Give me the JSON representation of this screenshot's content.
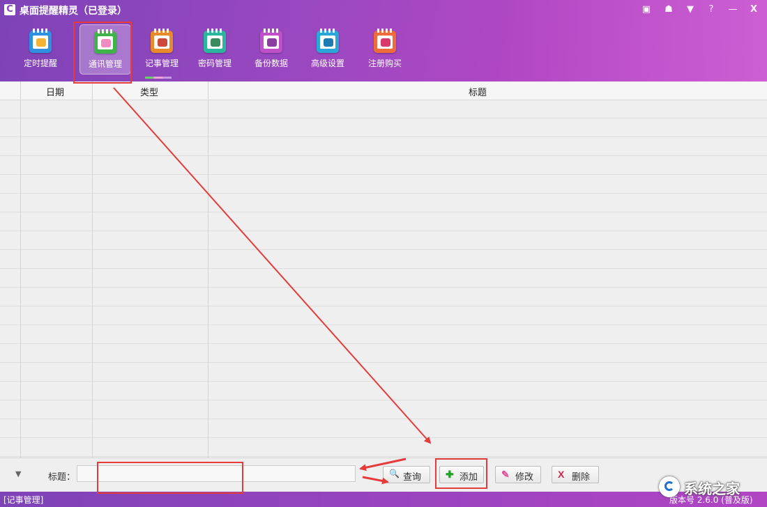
{
  "app": {
    "title": "桌面提醒精灵（已登录）",
    "logo_glyph": "C"
  },
  "window_controls": [
    {
      "name": "calendar-icon",
      "glyph": "▣"
    },
    {
      "name": "skin-icon",
      "glyph": "☗"
    },
    {
      "name": "menu-dropdown-icon",
      "glyph": "▼"
    },
    {
      "name": "help-icon",
      "glyph": "?"
    },
    {
      "name": "minimize-icon",
      "glyph": "—"
    },
    {
      "name": "close-icon",
      "glyph": "X"
    }
  ],
  "nav": {
    "items": [
      {
        "label": "定时提醒",
        "color": "#2f8fe0",
        "mark": "#f5b335",
        "icon": "alarm-clock-icon"
      },
      {
        "label": "通讯管理",
        "color": "#3fb24a",
        "mark": "#f08ac0",
        "icon": "contact-book-icon"
      },
      {
        "label": "记事管理",
        "color": "#e88a2c",
        "mark": "#cc4a3a",
        "icon": "notepad-pencil-icon"
      },
      {
        "label": "密码管理",
        "color": "#2bb6a0",
        "mark": "#3a8a60",
        "icon": "lock-icon"
      },
      {
        "label": "备份数据",
        "color": "#c050c8",
        "mark": "#8b3ea0",
        "icon": "floppy-disk-icon"
      },
      {
        "label": "高级设置",
        "color": "#2aa7d8",
        "mark": "#1e7db0",
        "icon": "gear-icon"
      },
      {
        "label": "注册购买",
        "color": "#f06b3a",
        "mark": "#d83a6a",
        "icon": "shopping-cart-icon"
      }
    ],
    "active_index": 1
  },
  "table": {
    "columns": [
      "日期",
      "类型",
      "标题"
    ],
    "rows": []
  },
  "bottom": {
    "expander_glyph": "▼",
    "title_label": "标题：",
    "title_value": "",
    "buttons": [
      {
        "label": "查询",
        "icon": "magnifier-icon",
        "glyph": "🔍",
        "color": "#3a7fd0"
      },
      {
        "label": "添加",
        "icon": "plus-icon",
        "glyph": "✚",
        "color": "#1ea31e"
      },
      {
        "label": "修改",
        "icon": "pencil-icon",
        "glyph": "✎",
        "color": "#e0509a"
      },
      {
        "label": "删除",
        "icon": "delete-x-icon",
        "glyph": "X",
        "color": "#d6204a"
      }
    ]
  },
  "status": {
    "left": "[记事管理]",
    "right": "版本号 2.6.0 (普及版)"
  },
  "watermark": {
    "text": "系统之家"
  },
  "colors": {
    "accent": "#9a48c0",
    "annotation": "#e53b3b"
  }
}
